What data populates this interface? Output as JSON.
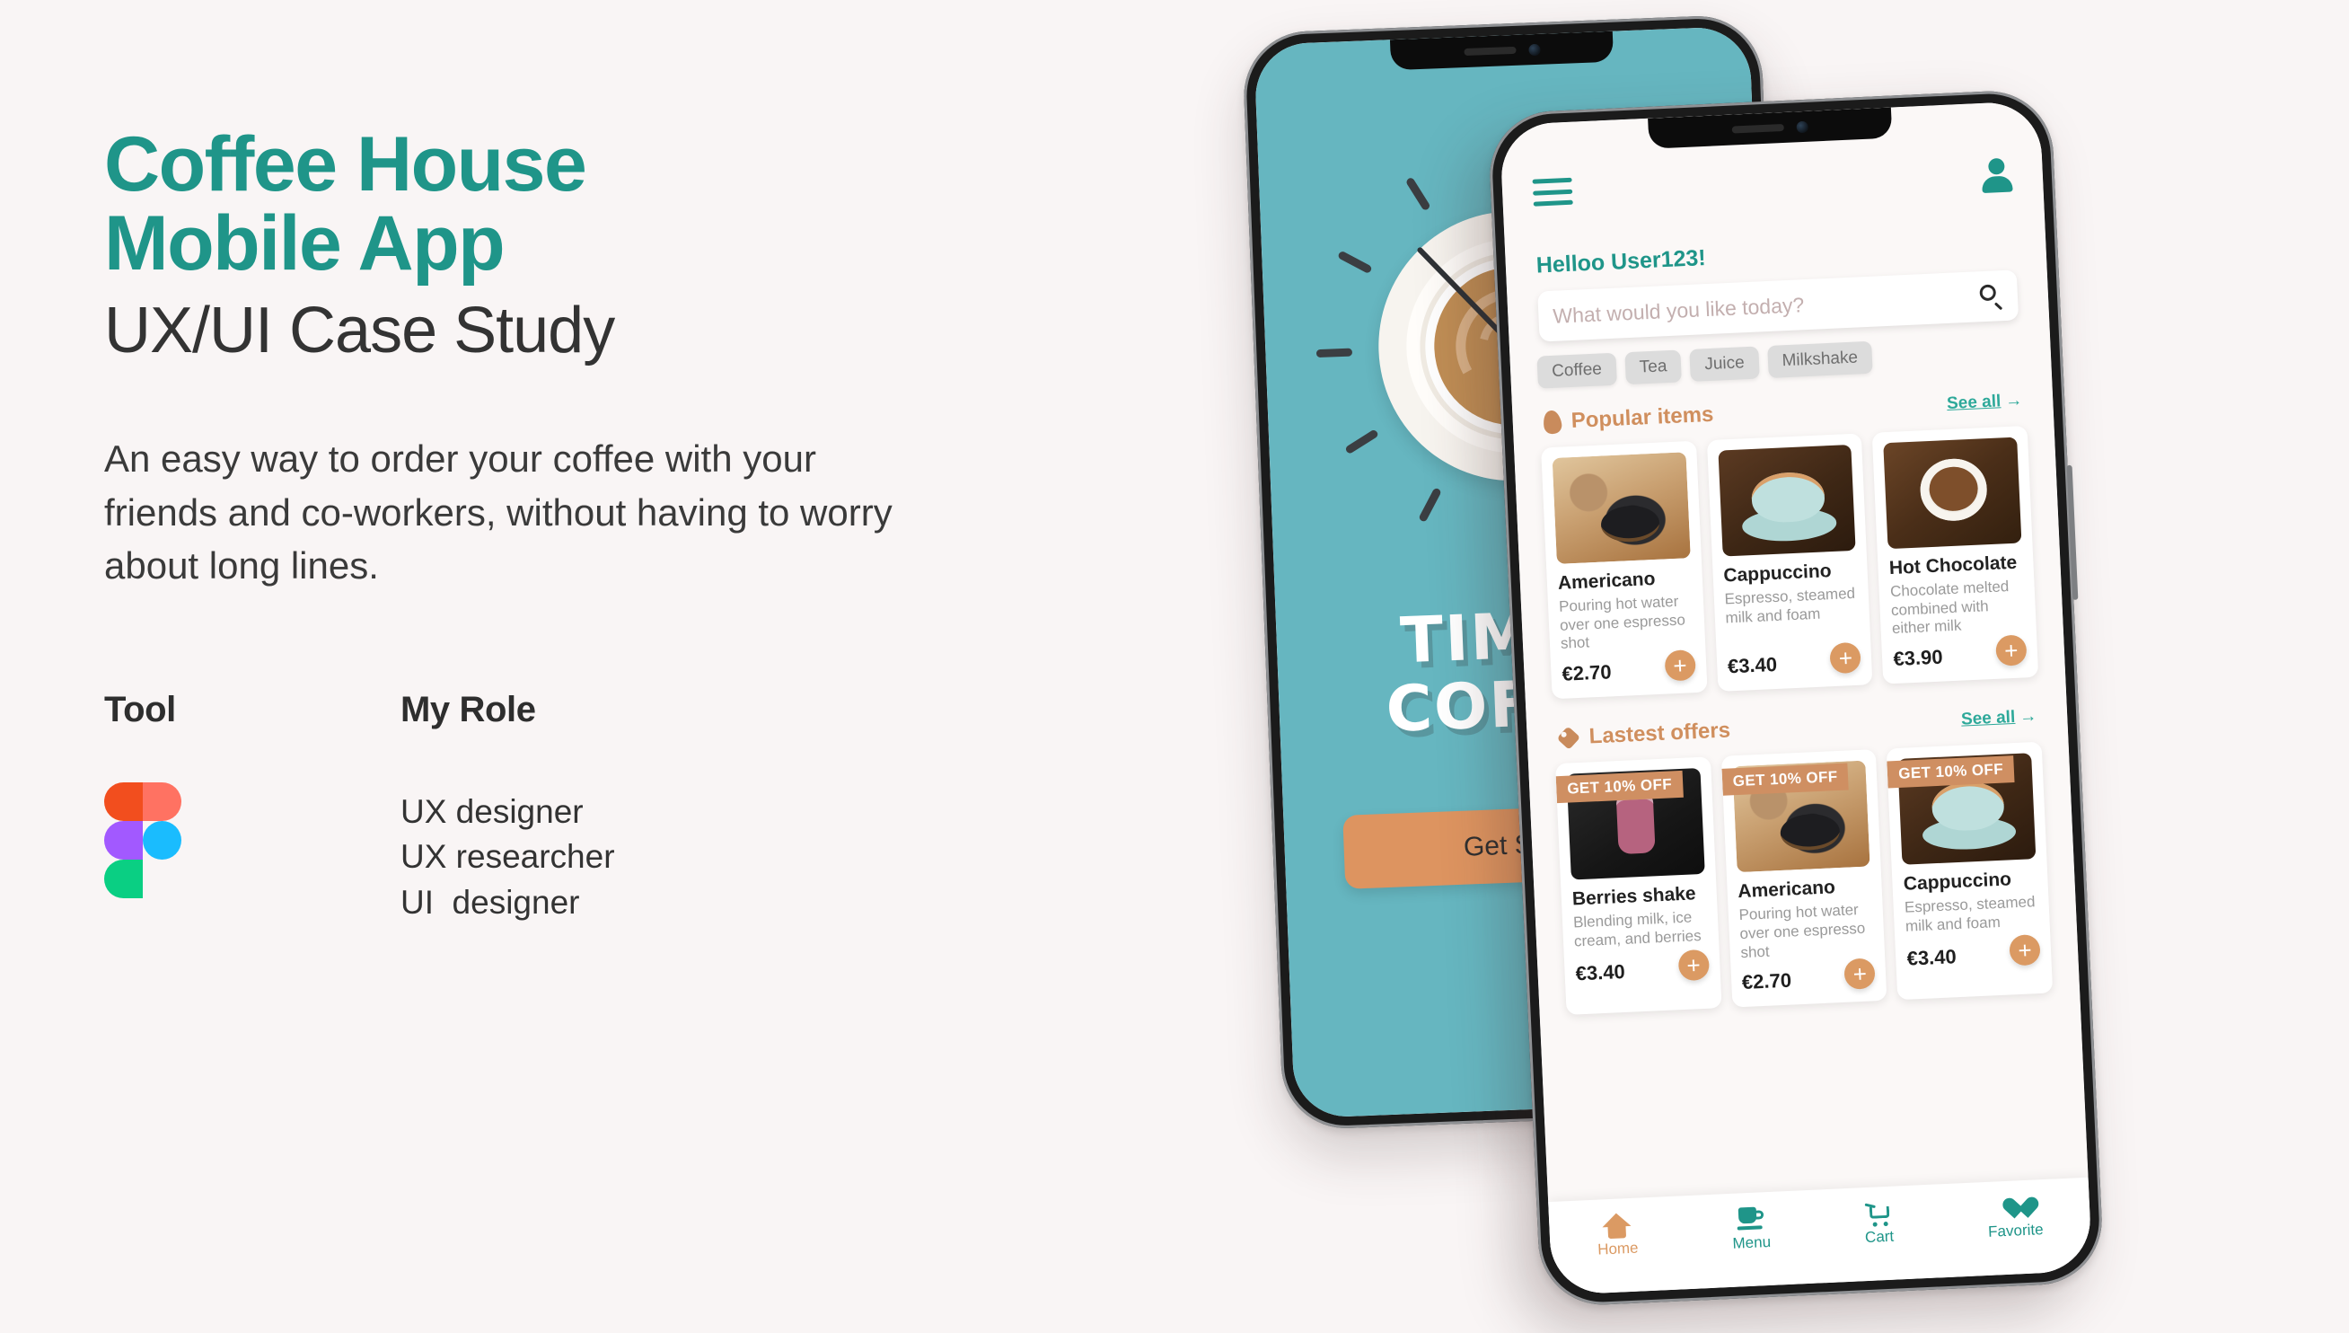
{
  "theme": {
    "background": "#F9F5F5",
    "accent_teal": "#1F9589",
    "accent_orange": "#DB9A63",
    "splash_teal": "#66B6C0",
    "text_dark": "#333333"
  },
  "hero": {
    "title_line1": "Coffee House",
    "title_line2": "Mobile App",
    "subtitle": "UX/UI Case Study",
    "description": "An easy way to order your coffee with your friends and co-workers, without having to worry about long lines."
  },
  "meta": {
    "tool_heading": "Tool",
    "tool_icon": "figma-logo",
    "role_heading": "My Role",
    "roles": [
      "UX designer",
      "UX researcher",
      "UI  designer"
    ]
  },
  "splash_screen": {
    "brand_line1": "TIME 2",
    "brand_line2": "COFFEE",
    "cta_label": "Get Started",
    "illustration": "coffee-cup-clock"
  },
  "app_screen": {
    "menu_icon": "hamburger-icon",
    "profile_icon": "user-avatar-icon",
    "greeting": "Helloo User123!",
    "search_placeholder": "What would you like today?",
    "search_icon": "search-icon",
    "categories": [
      "Coffee",
      "Tea",
      "Juice",
      "Milkshake"
    ],
    "sections": [
      {
        "icon": "flame-icon",
        "title": "Popular items",
        "see_all": "See all",
        "see_all_arrow": "→",
        "items": [
          {
            "name": "Americano",
            "desc": "Pouring hot water over one espresso shot",
            "price": "€2.70",
            "add": "+",
            "badge": null,
            "image": "americano-photo"
          },
          {
            "name": "Cappuccino",
            "desc": "Espresso, steamed milk and foam",
            "price": "€3.40",
            "add": "+",
            "badge": null,
            "image": "cappuccino-photo"
          },
          {
            "name": "Hot Chocolate",
            "desc": "Chocolate melted combined with either milk",
            "price": "€3.90",
            "add": "+",
            "badge": null,
            "image": "hot-chocolate-photo"
          }
        ]
      },
      {
        "icon": "tag-icon",
        "title": "Lastest offers",
        "see_all": "See all",
        "see_all_arrow": "→",
        "items": [
          {
            "name": "Berries shake",
            "desc": "Blending milk, ice cream, and berries",
            "price": "€3.40",
            "add": "+",
            "badge": "GET 10%  OFF",
            "image": "berries-shake-photo"
          },
          {
            "name": "Americano",
            "desc": "Pouring hot water over one espresso shot",
            "price": "€2.70",
            "add": "+",
            "badge": "GET 10%  OFF",
            "image": "americano-photo"
          },
          {
            "name": "Cappuccino",
            "desc": "Espresso, steamed milk and foam",
            "price": "€3.40",
            "add": "+",
            "badge": "GET 10%  OFF",
            "image": "cappuccino-photo"
          }
        ]
      }
    ],
    "bottom_nav": [
      {
        "label": "Home",
        "icon": "home-icon",
        "active": true
      },
      {
        "label": "Menu",
        "icon": "cup-icon",
        "active": false
      },
      {
        "label": "Cart",
        "icon": "cart-icon",
        "active": false
      },
      {
        "label": "Favorite",
        "icon": "heart-icon",
        "active": false
      }
    ]
  }
}
